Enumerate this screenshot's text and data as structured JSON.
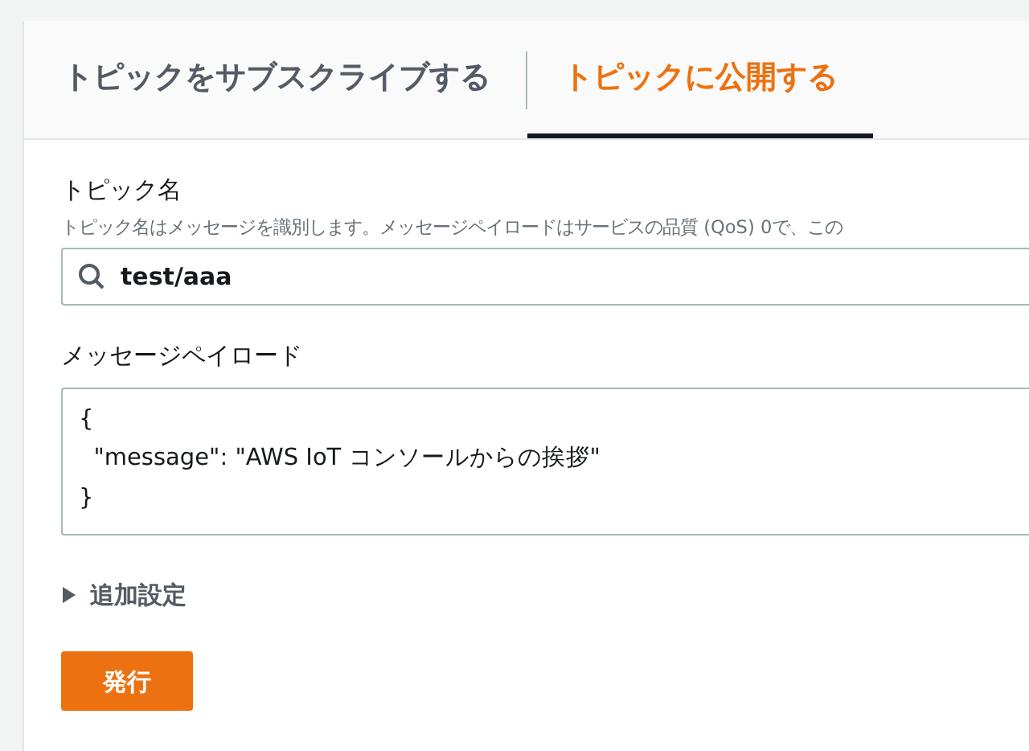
{
  "tabs": [
    {
      "label": "トピックをサブスクライブする",
      "selected": false
    },
    {
      "label": "トピックに公開する",
      "selected": true
    }
  ],
  "topic_name": {
    "label": "トピック名",
    "description": "トピック名はメッセージを識別します。メッセージペイロードはサービスの品質 (QoS) 0で、この",
    "value": "test/aaa"
  },
  "payload": {
    "label": "メッセージペイロード",
    "lines": [
      "{",
      "  \"message\": \"AWS IoT コンソールからの挨拶\"",
      "}"
    ]
  },
  "additional_settings": {
    "label": "追加設定",
    "expanded": false
  },
  "publish_button": "発行"
}
